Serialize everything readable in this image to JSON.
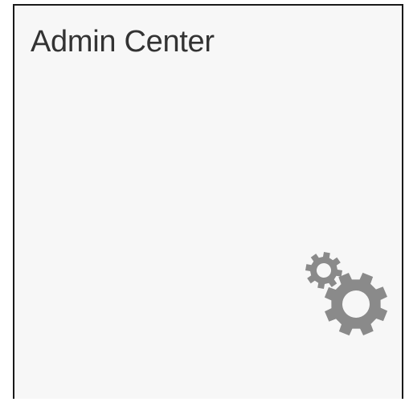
{
  "tile": {
    "title": "Admin Center",
    "icon": "gears-icon"
  },
  "colors": {
    "title_text": "#333333",
    "icon": "#8a8a8a",
    "tile_background": "#f7f7f7",
    "border": "#1a1a1a"
  }
}
